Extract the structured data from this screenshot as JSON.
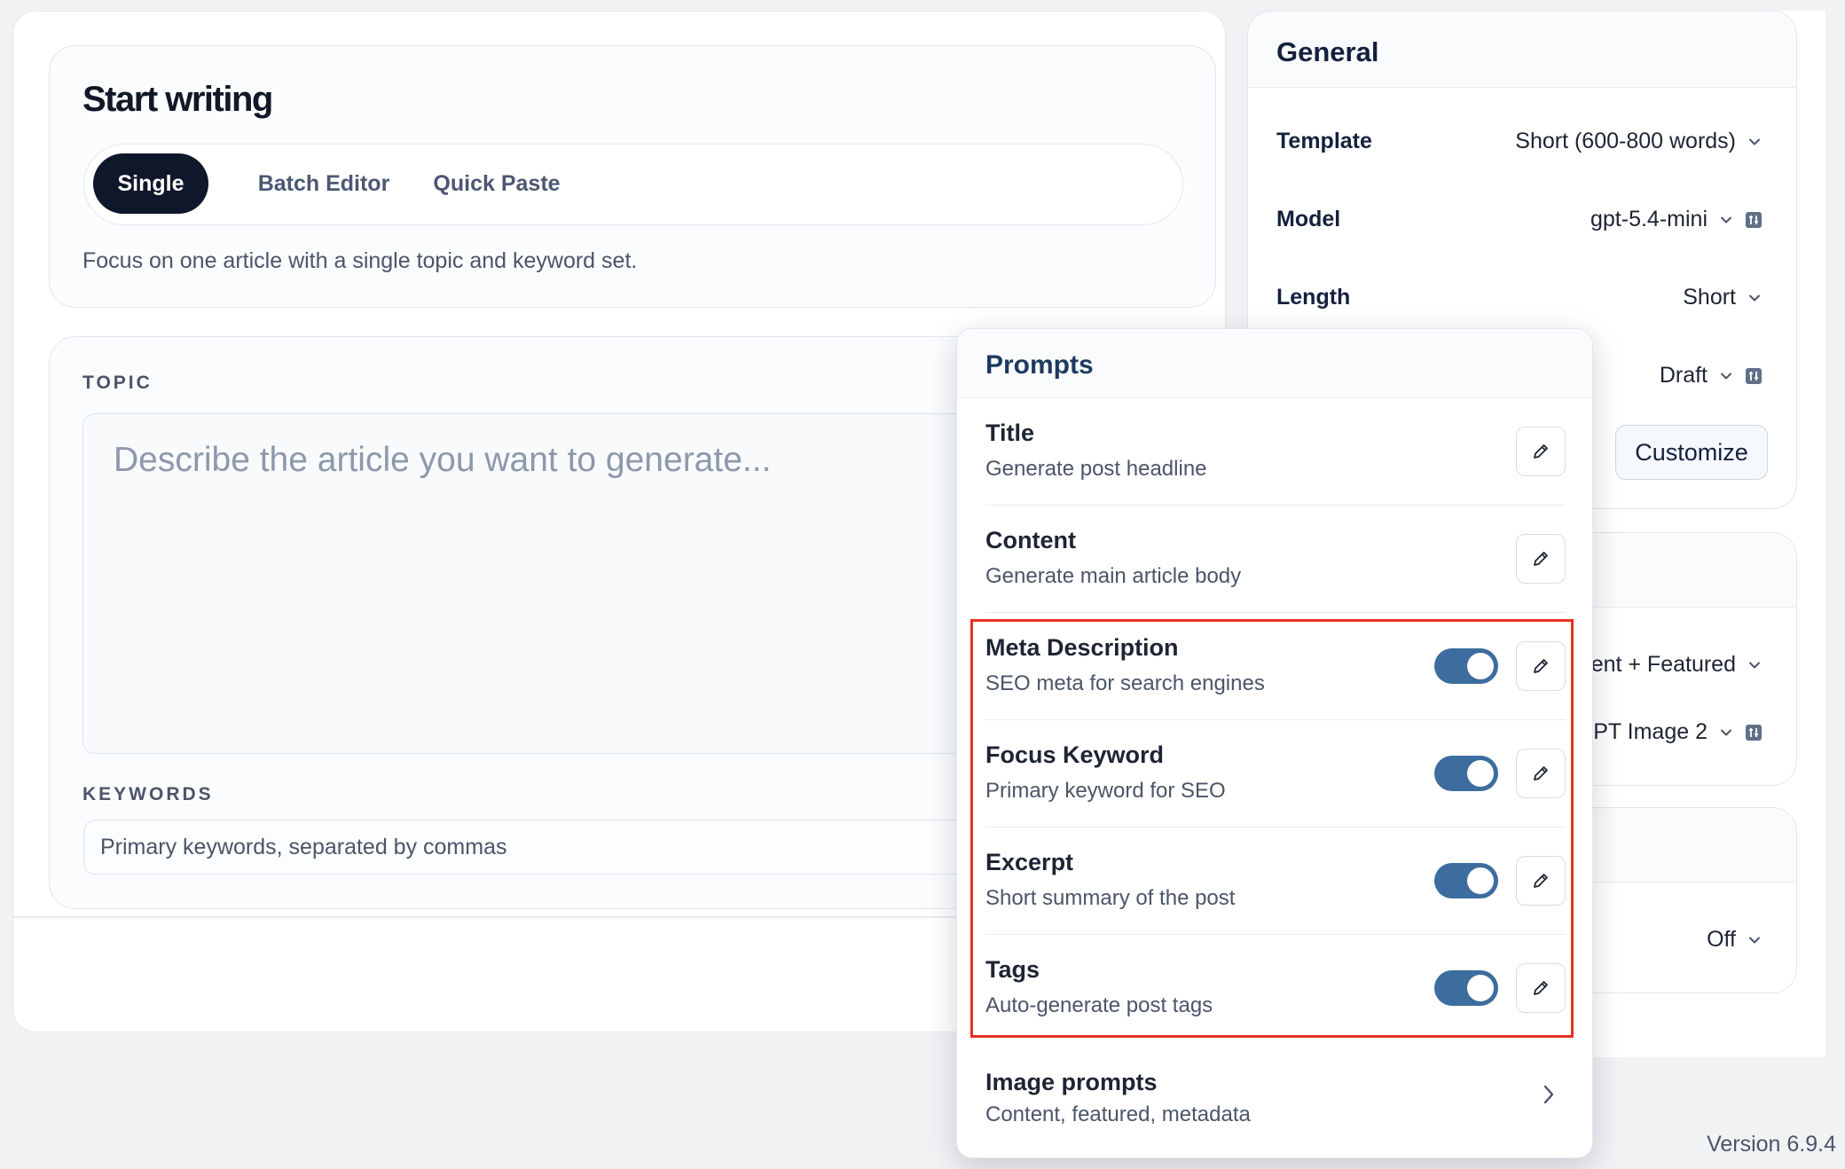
{
  "start": {
    "title": "Start writing",
    "tabs": [
      "Single",
      "Batch Editor",
      "Quick Paste"
    ],
    "active_tab": "Single",
    "description": "Focus on one article with a single topic and keyword set."
  },
  "topic": {
    "label": "TOPIC",
    "placeholder": "Describe the article you want to generate..."
  },
  "keywords": {
    "label": "KEYWORDS",
    "placeholder": "Primary keywords, separated by commas"
  },
  "general": {
    "title": "General",
    "rows": [
      {
        "label": "Template",
        "value": "Short (600-800 words)"
      },
      {
        "label": "Model",
        "value": "gpt-5.4-mini"
      },
      {
        "label": "Length",
        "value": "Short"
      },
      {
        "label": "",
        "value": "Draft"
      }
    ],
    "customize_label": "Customize"
  },
  "card2": {
    "rows": [
      {
        "value": "ent + Featured"
      },
      {
        "value": "PT Image 2"
      }
    ]
  },
  "card3": {
    "rows": [
      {
        "value": "Off"
      }
    ]
  },
  "prompts": {
    "title": "Prompts",
    "items": [
      {
        "name": "Title",
        "description": "Generate post headline",
        "has_toggle": false
      },
      {
        "name": "Content",
        "description": "Generate main article body",
        "has_toggle": false
      },
      {
        "name": "Meta Description",
        "description": "SEO meta for search engines",
        "has_toggle": true,
        "enabled": true
      },
      {
        "name": "Focus Keyword",
        "description": "Primary keyword for SEO",
        "has_toggle": true,
        "enabled": true
      },
      {
        "name": "Excerpt",
        "description": "Short summary of the post",
        "has_toggle": true,
        "enabled": true
      },
      {
        "name": "Tags",
        "description": "Auto-generate post tags",
        "has_toggle": true,
        "enabled": true
      }
    ],
    "image_prompts": {
      "name": "Image prompts",
      "description": "Content, featured, metadata"
    }
  },
  "footer": {
    "version": "Version 6.9.4"
  },
  "colors": {
    "accent_dark": "#0f172a",
    "toggle_on": "#3c6d9e",
    "highlight": "#e53222"
  }
}
